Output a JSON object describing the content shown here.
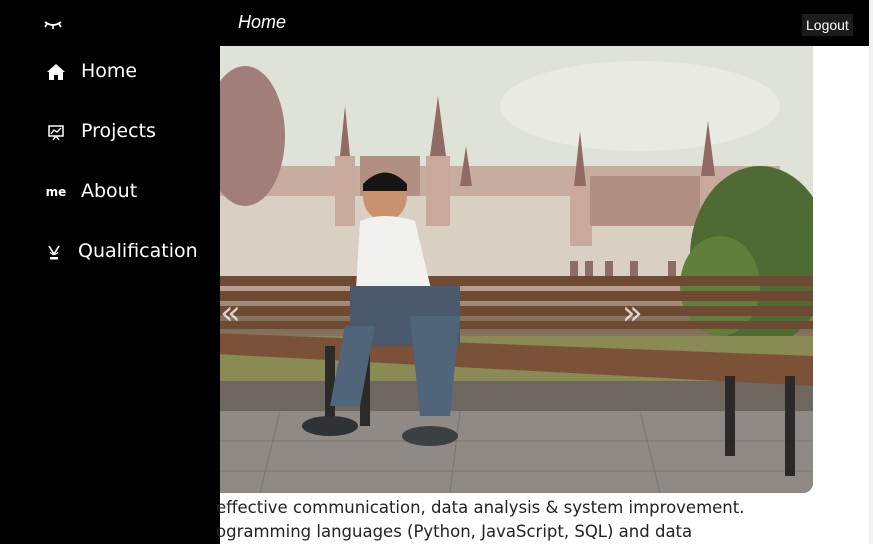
{
  "header": {
    "logo_icon": "closed-eye-icon",
    "title": "Home",
    "logout_label": "Logout"
  },
  "sidebar": {
    "items": [
      {
        "label": "Home",
        "icon": "home-icon"
      },
      {
        "label": "Projects",
        "icon": "presentation-icon"
      },
      {
        "label": "About",
        "icon_text": "me",
        "icon": "me-icon"
      },
      {
        "label": "Qualification",
        "icon": "graduation-cap-icon"
      }
    ]
  },
  "carousel": {
    "prev_icon": "double-chevron-left-icon",
    "next_icon": "double-chevron-right-icon",
    "prev_glyph": "«",
    "next_glyph": "»"
  },
  "about": {
    "line1": "effective communication, data analysis & system improvement.",
    "line2": "ogramming languages (Python, JavaScript, SQL) and data"
  },
  "colors": {
    "bar": "#000000",
    "sidebar": "#000000",
    "text": "#222222"
  }
}
